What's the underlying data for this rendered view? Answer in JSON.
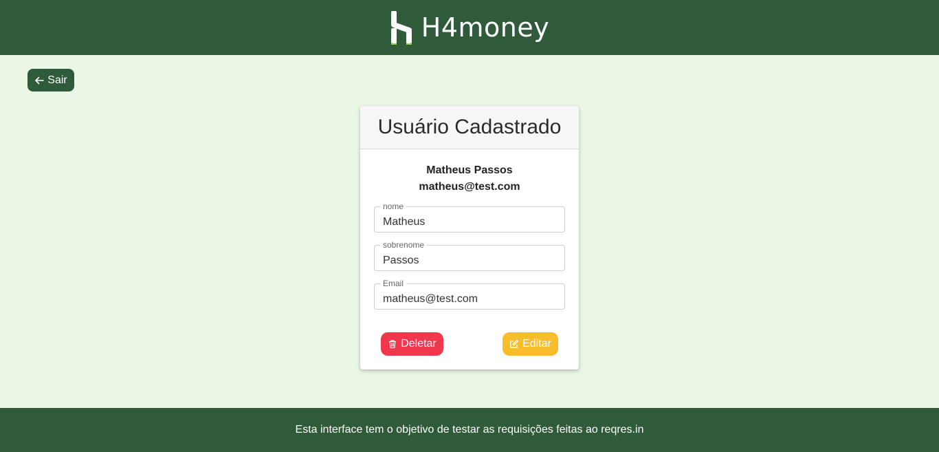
{
  "header": {
    "brand": "H4money",
    "logo_icon": "h4money-logo-icon"
  },
  "nav": {
    "back_label": "Sair",
    "back_icon": "arrow-left-icon"
  },
  "card": {
    "title": "Usuário Cadastrado",
    "user_name": "Matheus Passos",
    "user_email": "matheus@test.com",
    "fields": [
      {
        "label": "nome",
        "value": "Matheus"
      },
      {
        "label": "sobrenome",
        "value": "Passos"
      },
      {
        "label": "Email",
        "value": "matheus@test.com"
      }
    ],
    "delete_label": "Deletar",
    "edit_label": "Editar",
    "delete_icon": "trash-icon",
    "edit_icon": "edit-icon"
  },
  "footer": {
    "text": "Esta interface tem o objetivo de testar as requisições feitas ao reqres.in"
  },
  "colors": {
    "brand_green": "#2f5b3a",
    "page_bg": "#eaf6e6",
    "danger": "#f2364c",
    "warning": "#f7bd2a",
    "logo_accent": "#8fd14f"
  }
}
